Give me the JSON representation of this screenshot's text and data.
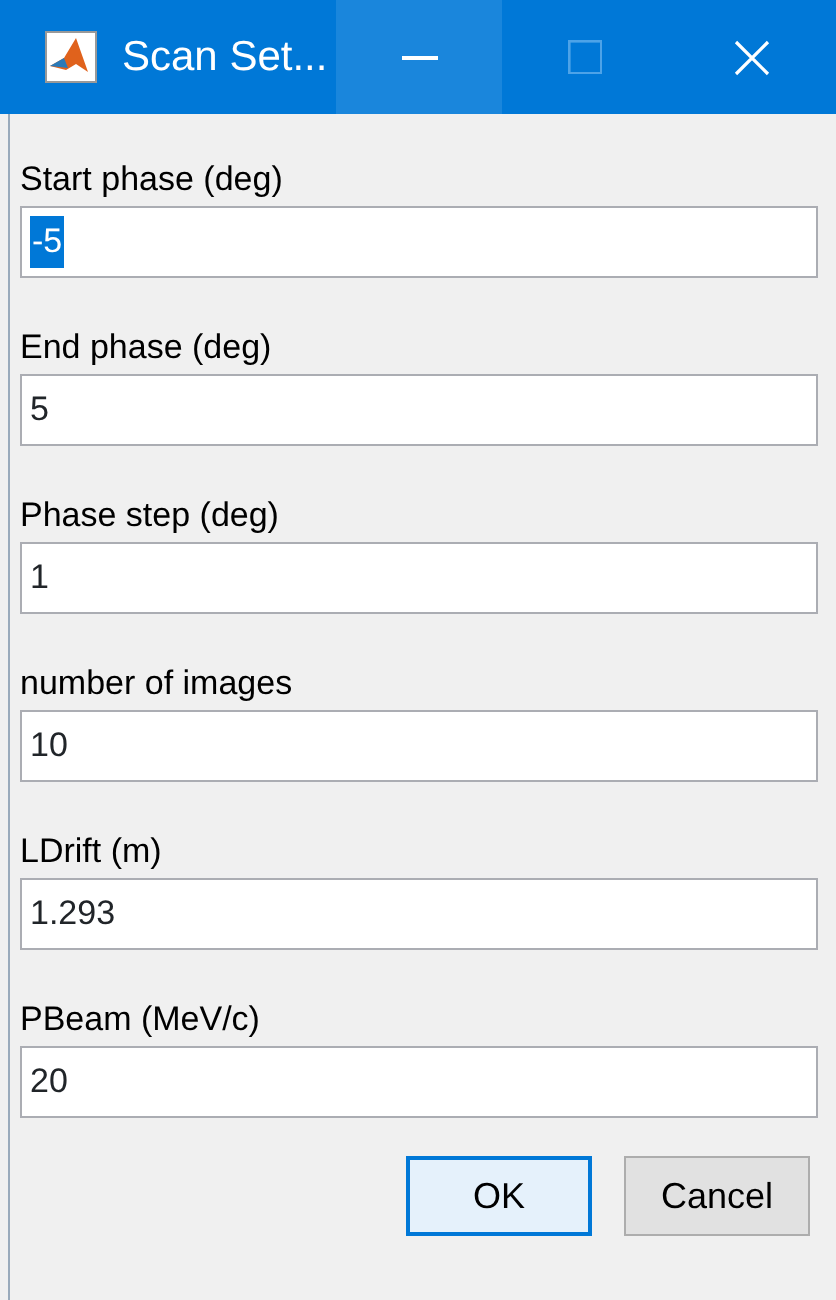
{
  "window": {
    "title": "Scan Set...",
    "controls": [
      {
        "kind": "minimize",
        "hovered": true,
        "disabled": false
      },
      {
        "kind": "maximize",
        "hovered": false,
        "disabled": true
      },
      {
        "kind": "close",
        "hovered": false,
        "disabled": false
      }
    ]
  },
  "fields": [
    {
      "label": "Start phase (deg)",
      "value": "-5",
      "selected": true
    },
    {
      "label": "End phase (deg)",
      "value": "5",
      "selected": false
    },
    {
      "label": "Phase step (deg)",
      "value": "1",
      "selected": false
    },
    {
      "label": "number of images",
      "value": "10",
      "selected": false
    },
    {
      "label": "LDrift (m)",
      "value": "1.293",
      "selected": false
    },
    {
      "label": "PBeam (MeV/c)",
      "value": "20",
      "selected": false
    }
  ],
  "buttons": [
    {
      "label": "OK",
      "default": true
    },
    {
      "label": "Cancel",
      "default": false
    }
  ]
}
